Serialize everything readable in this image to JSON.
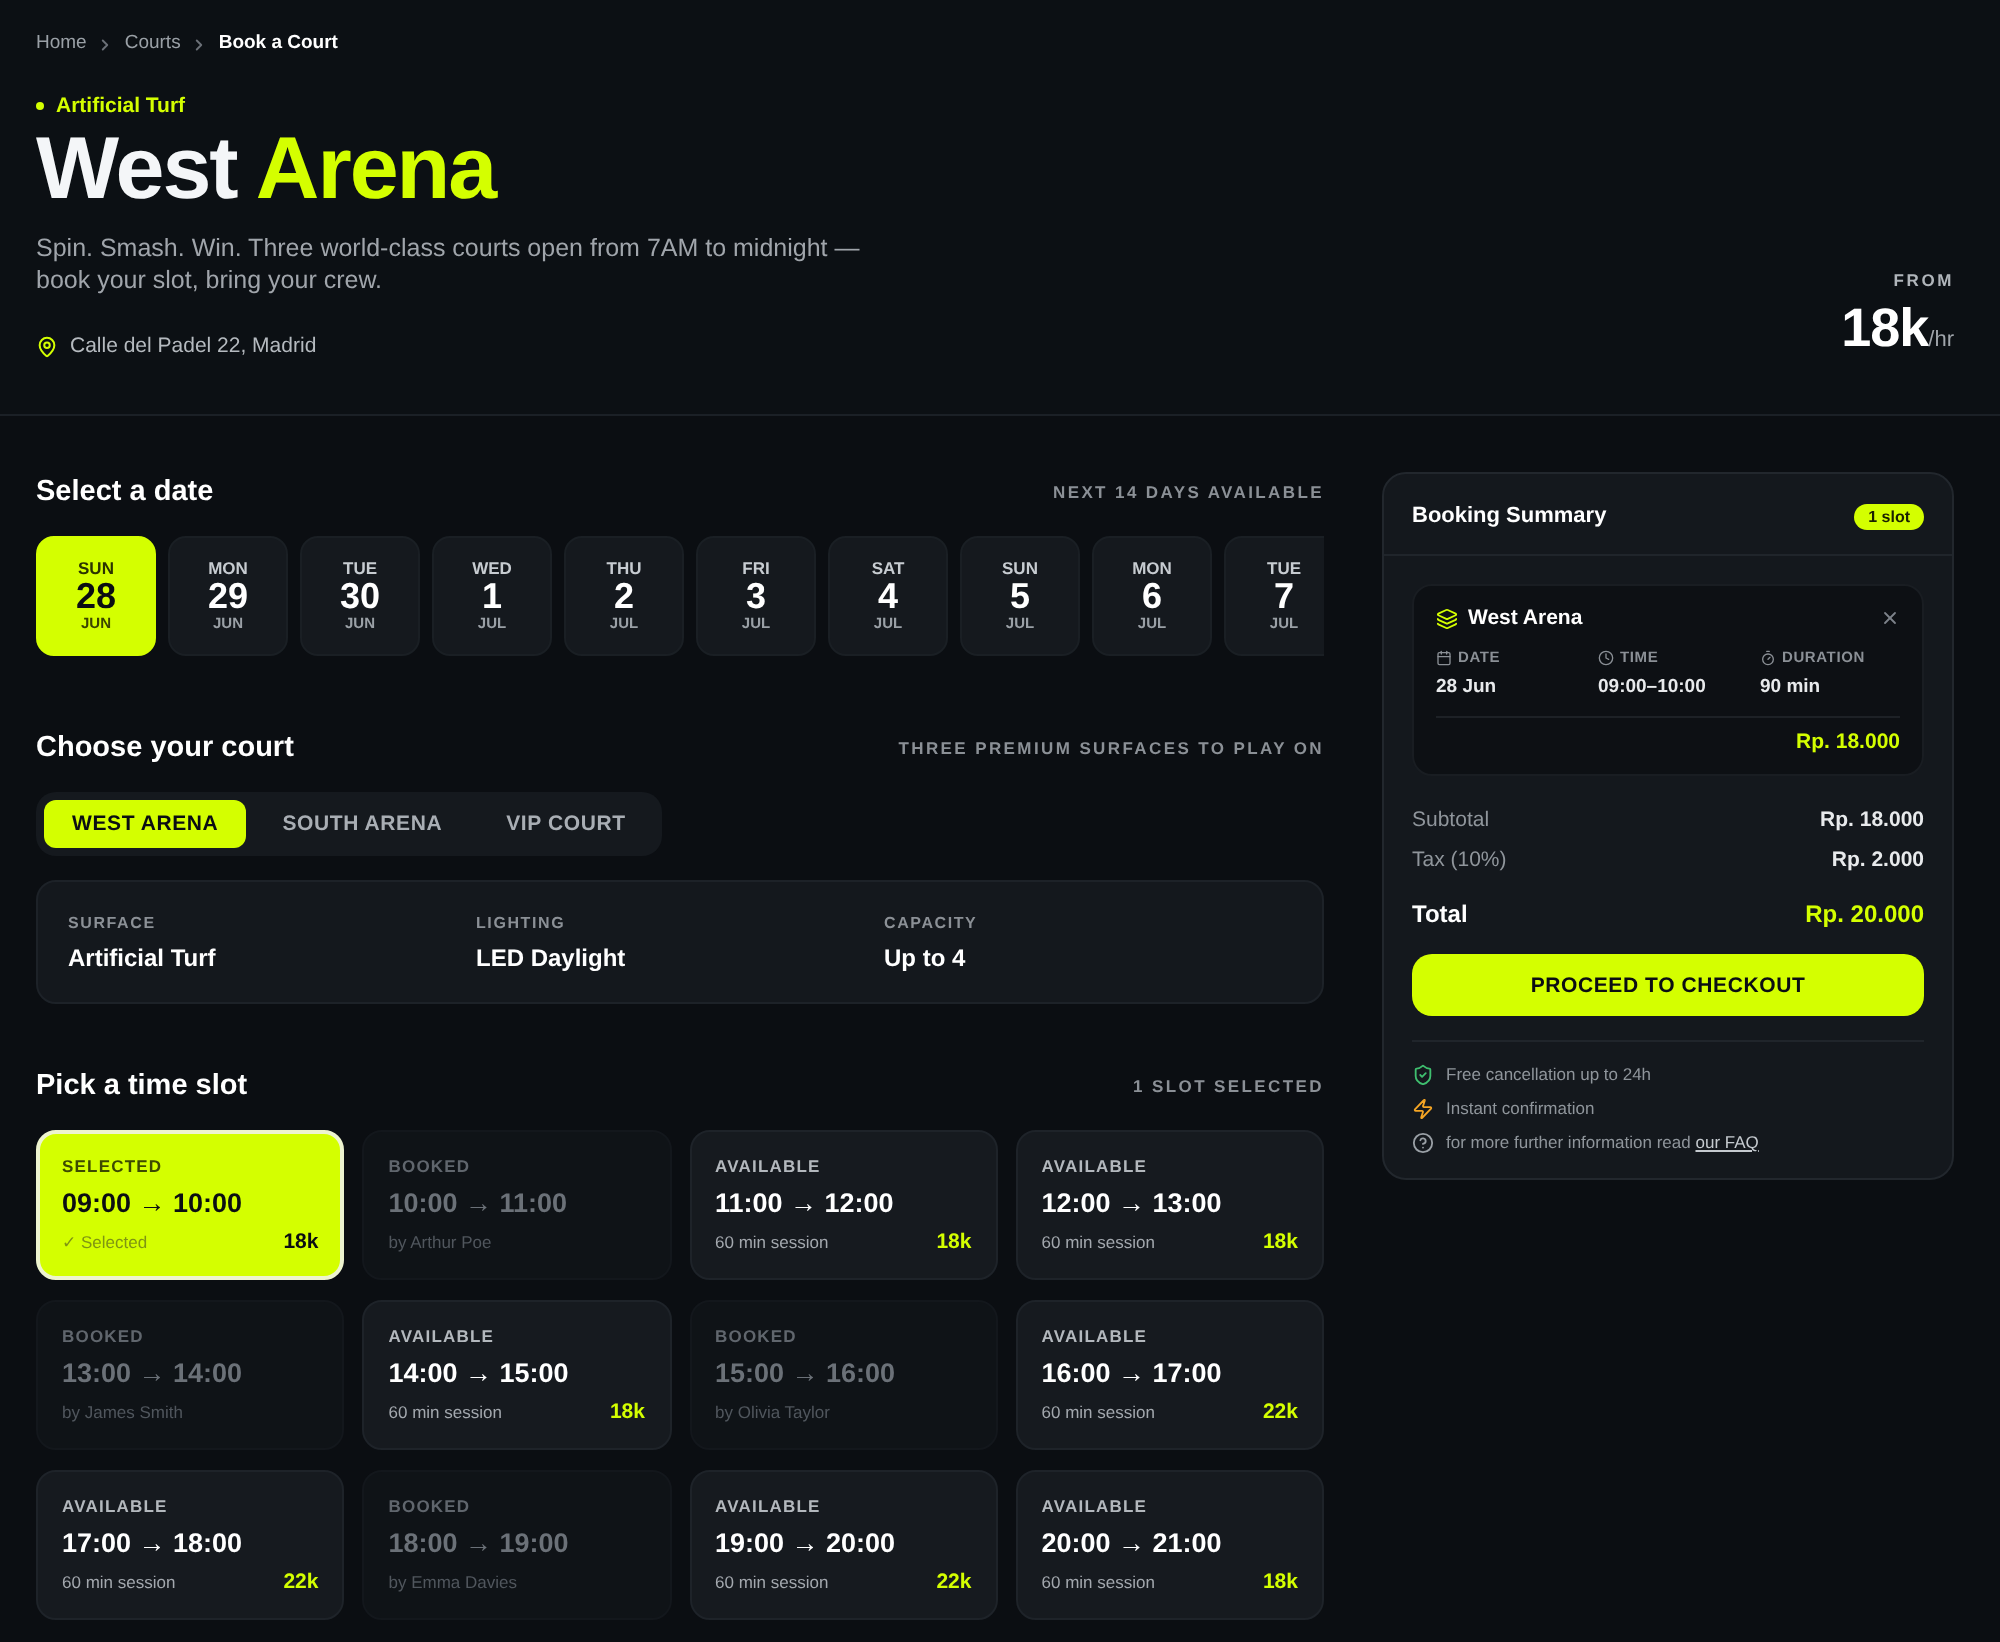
{
  "breadcrumb": [
    {
      "label": "Home",
      "current": false
    },
    {
      "label": "Courts",
      "current": false
    },
    {
      "label": "Book a Court",
      "current": true
    }
  ],
  "hero": {
    "tag": "Artificial Turf",
    "title": "West",
    "title_accent": "Arena",
    "description": "Spin. Smash. Win. Three world-class courts open from 7AM to midnight — book your slot, bring your crew.",
    "address": "Calle del Padel 22, Madrid",
    "price_label": "FROM",
    "price": "18k",
    "price_unit": "/hr"
  },
  "dates": {
    "heading": "Select a date",
    "note": "NEXT 14 DAYS AVAILABLE",
    "days": [
      {
        "weekday": "SUN",
        "day": "28",
        "month": "JUN",
        "selected": true
      },
      {
        "weekday": "MON",
        "day": "29",
        "month": "JUN",
        "selected": false
      },
      {
        "weekday": "TUE",
        "day": "30",
        "month": "JUN",
        "selected": false
      },
      {
        "weekday": "WED",
        "day": "1",
        "month": "JUL",
        "selected": false
      },
      {
        "weekday": "THU",
        "day": "2",
        "month": "JUL",
        "selected": false
      },
      {
        "weekday": "FRI",
        "day": "3",
        "month": "JUL",
        "selected": false
      },
      {
        "weekday": "SAT",
        "day": "4",
        "month": "JUL",
        "selected": false
      },
      {
        "weekday": "SUN",
        "day": "5",
        "month": "JUL",
        "selected": false
      },
      {
        "weekday": "MON",
        "day": "6",
        "month": "JUL",
        "selected": false
      },
      {
        "weekday": "TUE",
        "day": "7",
        "month": "JUL",
        "selected": false
      }
    ]
  },
  "court": {
    "heading": "Choose your court",
    "note": "THREE PREMIUM SURFACES TO PLAY ON",
    "tabs": [
      {
        "label": "WEST ARENA",
        "selected": true
      },
      {
        "label": "SOUTH ARENA",
        "selected": false
      },
      {
        "label": "VIP COURT",
        "selected": false
      }
    ],
    "details": [
      {
        "label": "SURFACE",
        "value": "Artificial Turf"
      },
      {
        "label": "LIGHTING",
        "value": "LED Daylight"
      },
      {
        "label": "CAPACITY",
        "value": "Up to 4"
      }
    ]
  },
  "slots": {
    "heading": "Pick a time slot",
    "note": "1 SLOT SELECTED",
    "items": [
      {
        "kind": "available",
        "selected": true,
        "status": "SELECTED",
        "time": "09:00 → 10:00",
        "detail": "✓ Selected",
        "price": "18k"
      },
      {
        "kind": "booked",
        "selected": false,
        "status": "BOOKED",
        "time": "10:00 → 11:00",
        "detail": "by Arthur Poe"
      },
      {
        "kind": "available",
        "selected": false,
        "status": "AVAILABLE",
        "time": "11:00 → 12:00",
        "detail": "60 min session",
        "price": "18k"
      },
      {
        "kind": "available",
        "selected": false,
        "status": "AVAILABLE",
        "time": "12:00 → 13:00",
        "detail": "60 min session",
        "price": "18k"
      },
      {
        "kind": "booked",
        "selected": false,
        "status": "BOOKED",
        "time": "13:00 → 14:00",
        "detail": "by James Smith"
      },
      {
        "kind": "available",
        "selected": false,
        "status": "AVAILABLE",
        "time": "14:00 → 15:00",
        "detail": "60 min session",
        "price": "18k"
      },
      {
        "kind": "booked",
        "selected": false,
        "status": "BOOKED",
        "time": "15:00 → 16:00",
        "detail": "by Olivia Taylor"
      },
      {
        "kind": "available",
        "selected": false,
        "status": "AVAILABLE",
        "time": "16:00 → 17:00",
        "detail": "60 min session",
        "price": "22k"
      },
      {
        "kind": "available",
        "selected": false,
        "status": "AVAILABLE",
        "time": "17:00 → 18:00",
        "detail": "60 min session",
        "price": "22k"
      },
      {
        "kind": "booked",
        "selected": false,
        "status": "BOOKED",
        "time": "18:00 → 19:00",
        "detail": "by Emma Davies"
      },
      {
        "kind": "available",
        "selected": false,
        "status": "AVAILABLE",
        "time": "19:00 → 20:00",
        "detail": "60 min session",
        "price": "22k"
      },
      {
        "kind": "available",
        "selected": false,
        "status": "AVAILABLE",
        "time": "20:00 → 21:00",
        "detail": "60 min session",
        "price": "18k"
      }
    ]
  },
  "summary": {
    "title": "Booking Summary",
    "badge": "1 slot",
    "booking": {
      "court": "West Arena",
      "fields": [
        {
          "kind": "date",
          "label": "DATE",
          "value": "28 Jun"
        },
        {
          "kind": "time",
          "label": "TIME",
          "value": "09:00–10:00"
        },
        {
          "kind": "duration",
          "label": "DURATION",
          "value": "90 min"
        }
      ],
      "price": "Rp. 18.000"
    },
    "lines": [
      {
        "label": "Subtotal",
        "value": "Rp. 18.000"
      },
      {
        "label": "Tax (10%)",
        "value": "Rp. 2.000"
      }
    ],
    "total": {
      "label": "Total",
      "value": "Rp. 20.000"
    },
    "checkout": "PROCEED TO CHECKOUT",
    "perks": [
      {
        "kind": "cancellation",
        "text": "Free cancellation up to 24h"
      },
      {
        "kind": "instant",
        "text": "Instant confirmation"
      },
      {
        "kind": "info",
        "text": "for more further information read",
        "link": "our FAQ"
      }
    ]
  }
}
